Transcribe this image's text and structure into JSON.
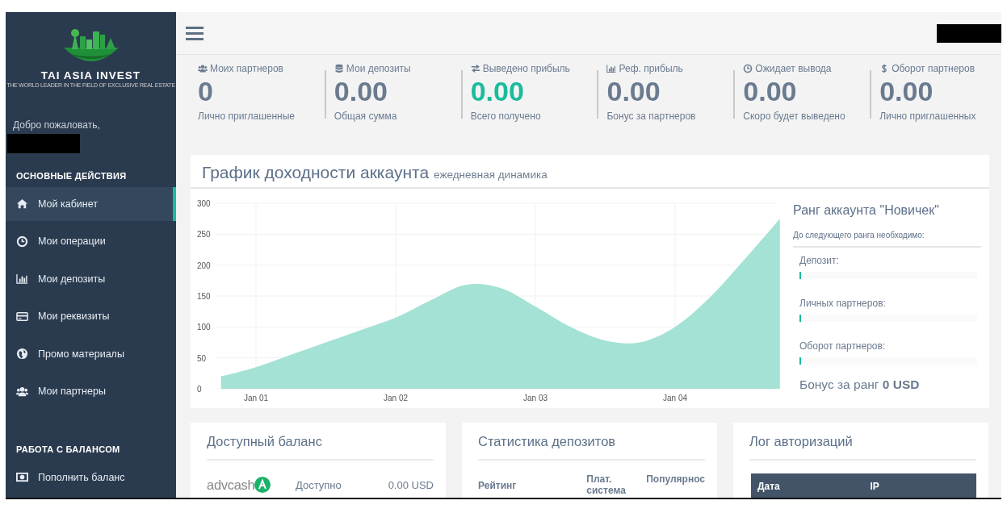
{
  "sidebar": {
    "logo": {
      "name": "TAI ASIA INVEST",
      "tagline": "THE WORLD LEADER IN THE FIELD OF EXCLUSIVE REAL ESTATE"
    },
    "welcome": "Добро пожаловать,",
    "sections": [
      {
        "title": "ОСНОВНЫЕ ДЕЙСТВИЯ",
        "items": [
          {
            "label": "Мой кабинет",
            "selected": true
          },
          {
            "label": "Мои операции",
            "selected": false
          },
          {
            "label": "Мои депозиты",
            "selected": false
          },
          {
            "label": "Мои реквизиты",
            "selected": false
          },
          {
            "label": "Промо материалы",
            "selected": false
          },
          {
            "label": "Мои партнеры",
            "selected": false
          }
        ]
      },
      {
        "title": "РАБОТА С БАЛАНСОМ",
        "items": [
          {
            "label": "Пополнить баланс",
            "selected": false
          }
        ]
      }
    ]
  },
  "stats": [
    {
      "label": "Моих партнеров",
      "value": "0",
      "caption": "Лично приглашенные",
      "color": "#6b7b8f"
    },
    {
      "label": "Мои депозиты",
      "value": "0.00",
      "caption": "Общая сумма",
      "color": "#6b7b8f"
    },
    {
      "label": "Выведено прибыль",
      "value": "0.00",
      "caption": "Всего получено",
      "color": "#1abc9c"
    },
    {
      "label": "Реф. прибыль",
      "value": "0.00",
      "caption": "Бонус за партнеров",
      "color": "#6b7b8f"
    },
    {
      "label": "Ожидает вывода",
      "value": "0.00",
      "caption": "Скоро будет выведено",
      "color": "#6b7b8f"
    },
    {
      "label": "Оборот партнеров",
      "value": "0.00",
      "caption": "Лично приглашенных",
      "color": "#6b7b8f"
    }
  ],
  "income": {
    "title": "График доходности аккаунта",
    "subtitle": "ежедневная динамика",
    "chart_data": {
      "type": "area",
      "categories": [
        null,
        "Jan 01",
        null,
        null,
        null,
        "Jan 02",
        null,
        null,
        null,
        "Jan 03",
        null,
        null,
        null,
        "Jan 04",
        null,
        null,
        null
      ],
      "grid": true,
      "yticks": [
        0,
        50,
        100,
        150,
        200,
        250,
        300
      ],
      "ylim": [
        0,
        300
      ],
      "series": [
        {
          "color": "#a3e2d5",
          "values": [
            20,
            35,
            55,
            75,
            95,
            115,
            143,
            168,
            163,
            133,
            100,
            78,
            75,
            100,
            148,
            210,
            275
          ]
        }
      ]
    },
    "rank": {
      "title": "Ранг аккаунта \"Новичек\"",
      "subtitle": "До следующего ранга необходимо:",
      "requirements": [
        {
          "label": "Депозит:",
          "level": 0.01
        },
        {
          "label": "Личных партнеров:",
          "level": 0.01
        },
        {
          "label": "Оборот партнеров:",
          "level": 0.01
        }
      ],
      "bonus": "Бонус за ранг **0 USD**"
    }
  },
  "balance": {
    "title": "Доступный баланс",
    "rows": [
      {
        "system": "advcash",
        "label": "Доступно",
        "amount": "0.00 USD"
      }
    ]
  },
  "deposit_stats": {
    "title": "Статистика депозитов",
    "columns": [
      "Рейтинг",
      "Плат. система",
      "Популярнос"
    ]
  },
  "auth_log": {
    "title": "Лог авторизаций",
    "columns": [
      "Дата",
      "IP"
    ]
  }
}
